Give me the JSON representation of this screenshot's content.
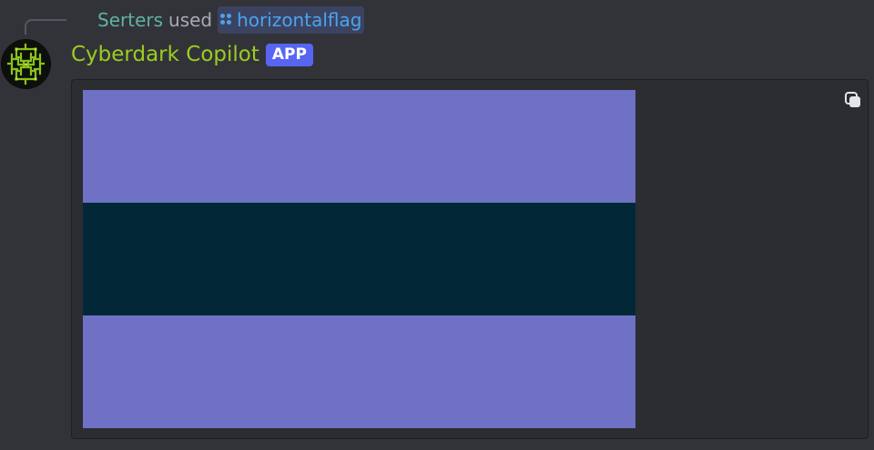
{
  "reply": {
    "user": "Serters",
    "used": "used",
    "command": "horizontalflag"
  },
  "author": {
    "name": "Cyberdark Copilot",
    "badge": "APP",
    "avatar_icon": "circuit-avatar-icon"
  },
  "embed": {
    "action_icon": "copy-icon",
    "flag_stripes": [
      "#6e71c4",
      "#022838",
      "#6e71c4"
    ]
  },
  "colors": {
    "background": "#323339",
    "embed_background": "#2b2d31",
    "username": "#9ccd1f",
    "reply_user": "#5fb3a0",
    "command": "#4aa3f0",
    "badge": "#5865f2"
  }
}
